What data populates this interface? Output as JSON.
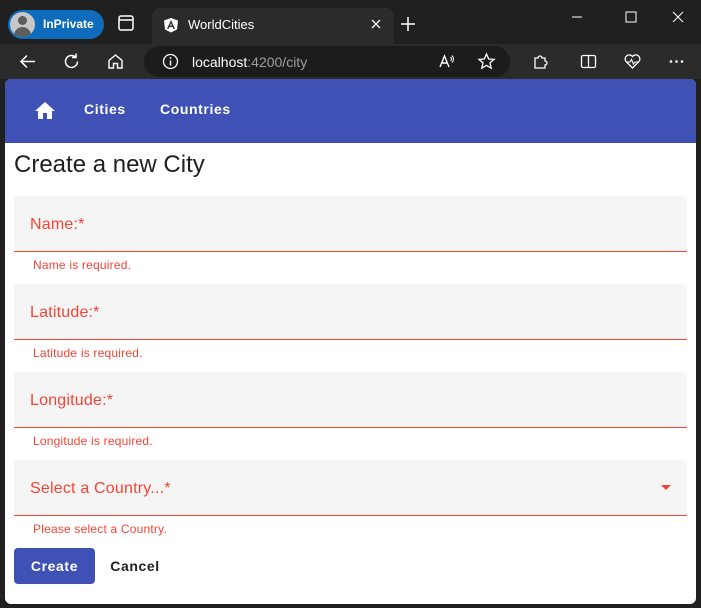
{
  "browser": {
    "profile_label": "InPrivate",
    "tab_title": "WorldCities",
    "url_host": "localhost",
    "url_rest": ":4200/city"
  },
  "nav": {
    "links": [
      "Cities",
      "Countries"
    ]
  },
  "form": {
    "title": "Create a new City",
    "fields": [
      {
        "label": "Name:*",
        "error": "Name is required."
      },
      {
        "label": "Latitude:*",
        "error": "Latitude is required."
      },
      {
        "label": "Longitude:*",
        "error": "Longitude is required."
      },
      {
        "label": "Select a Country...*",
        "error": "Please select a Country."
      }
    ],
    "create_label": "Create",
    "cancel_label": "Cancel"
  },
  "colors": {
    "primary": "#3f51b5",
    "error": "#f44336"
  }
}
